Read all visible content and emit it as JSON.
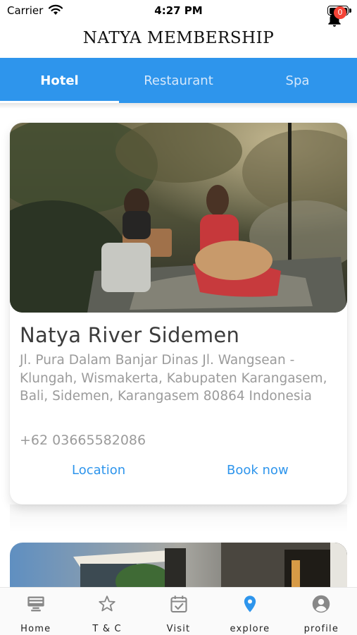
{
  "status_bar": {
    "carrier": "Carrier",
    "time": "4:27 PM"
  },
  "header": {
    "title": "NATYA MEMBERSHIP",
    "notification_count": "0"
  },
  "tabs": [
    {
      "label": "Hotel",
      "active": true
    },
    {
      "label": "Restaurant",
      "active": false
    },
    {
      "label": "Spa",
      "active": false
    }
  ],
  "hotels": [
    {
      "name": "Natya River Sidemen",
      "address": "Jl. Pura Dalam Banjar Dinas Jl. Wangsean - Klungah, Wismakerta, Kabupaten Karangasem, Bali, Sidemen, Karangasem 80864 Indonesia",
      "phone": "+62 03665582086",
      "location_label": "Location",
      "book_label": "Book now"
    }
  ],
  "bottom_nav": [
    {
      "label": "Home",
      "icon": "monitor-icon",
      "active": false
    },
    {
      "label": "T & C",
      "icon": "star-icon",
      "active": false
    },
    {
      "label": "Visit",
      "icon": "calendar-check-icon",
      "active": false
    },
    {
      "label": "explore",
      "icon": "location-pin-icon",
      "active": true
    },
    {
      "label": "profile",
      "icon": "account-circle-icon",
      "active": false
    }
  ],
  "colors": {
    "primary": "#2e95ec",
    "badge": "#f44336",
    "muted_text": "#9b9b9b",
    "title_text": "#3c3c3c"
  }
}
